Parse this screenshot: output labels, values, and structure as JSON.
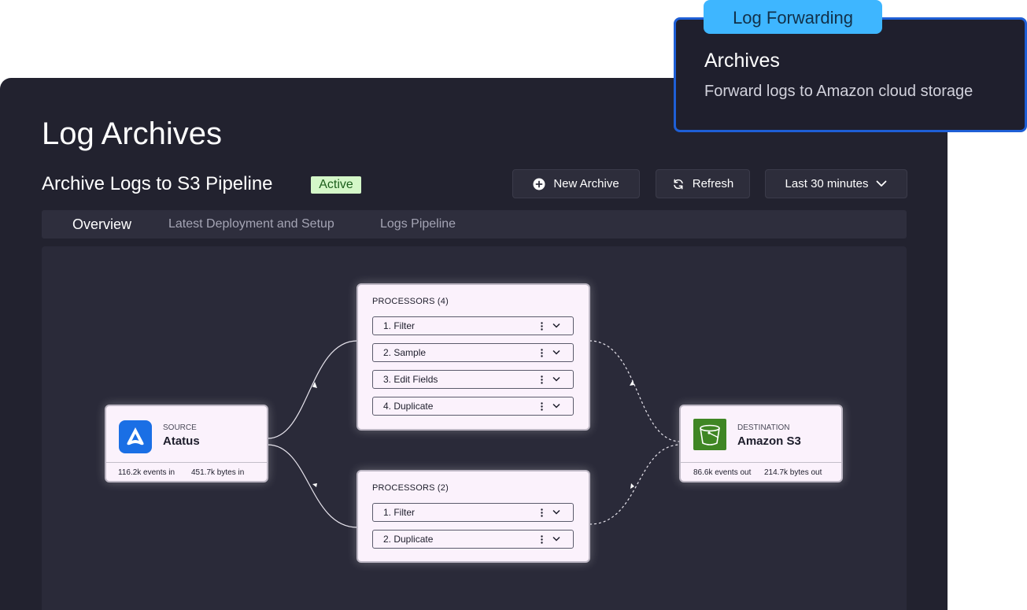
{
  "callout": {
    "tag": "Log Forwarding",
    "title": "Archives",
    "description": "Forward logs to Amazon cloud storage"
  },
  "page": {
    "title": "Log Archives",
    "pipeline_title": "Archive Logs to S3 Pipeline",
    "status": "Active"
  },
  "toolbar": {
    "new_archive": "New Archive",
    "refresh": "Refresh",
    "time_range": "Last 30 minutes"
  },
  "tabs": [
    {
      "label": "Overview",
      "active": true
    },
    {
      "label": "Latest Deployment and Setup",
      "active": false
    },
    {
      "label": "Logs Pipeline",
      "active": false
    }
  ],
  "source": {
    "kicker": "SOURCE",
    "name": "Atatus",
    "events": "116.2k events in",
    "bytes": "451.7k bytes in",
    "icon": "atatus-logo-icon",
    "color": "#1a6fe5"
  },
  "destination": {
    "kicker": "DESTINATION",
    "name": "Amazon S3",
    "events": "86.6k events out",
    "bytes": "214.7k bytes out",
    "icon": "s3-bucket-icon",
    "color": "#3f8624"
  },
  "processors": [
    {
      "title": "PROCESSORS (4)",
      "items": [
        "1. Filter",
        "2. Sample",
        "3. Edit Fields",
        "4. Duplicate"
      ]
    },
    {
      "title": "PROCESSORS (2)",
      "items": [
        "1. Filter",
        "2. Duplicate"
      ]
    }
  ],
  "colors": {
    "background": "#22222f",
    "accent": "#3eb6ff",
    "callout_border": "#1e5fd6",
    "active_badge": "#d4f7c8"
  }
}
